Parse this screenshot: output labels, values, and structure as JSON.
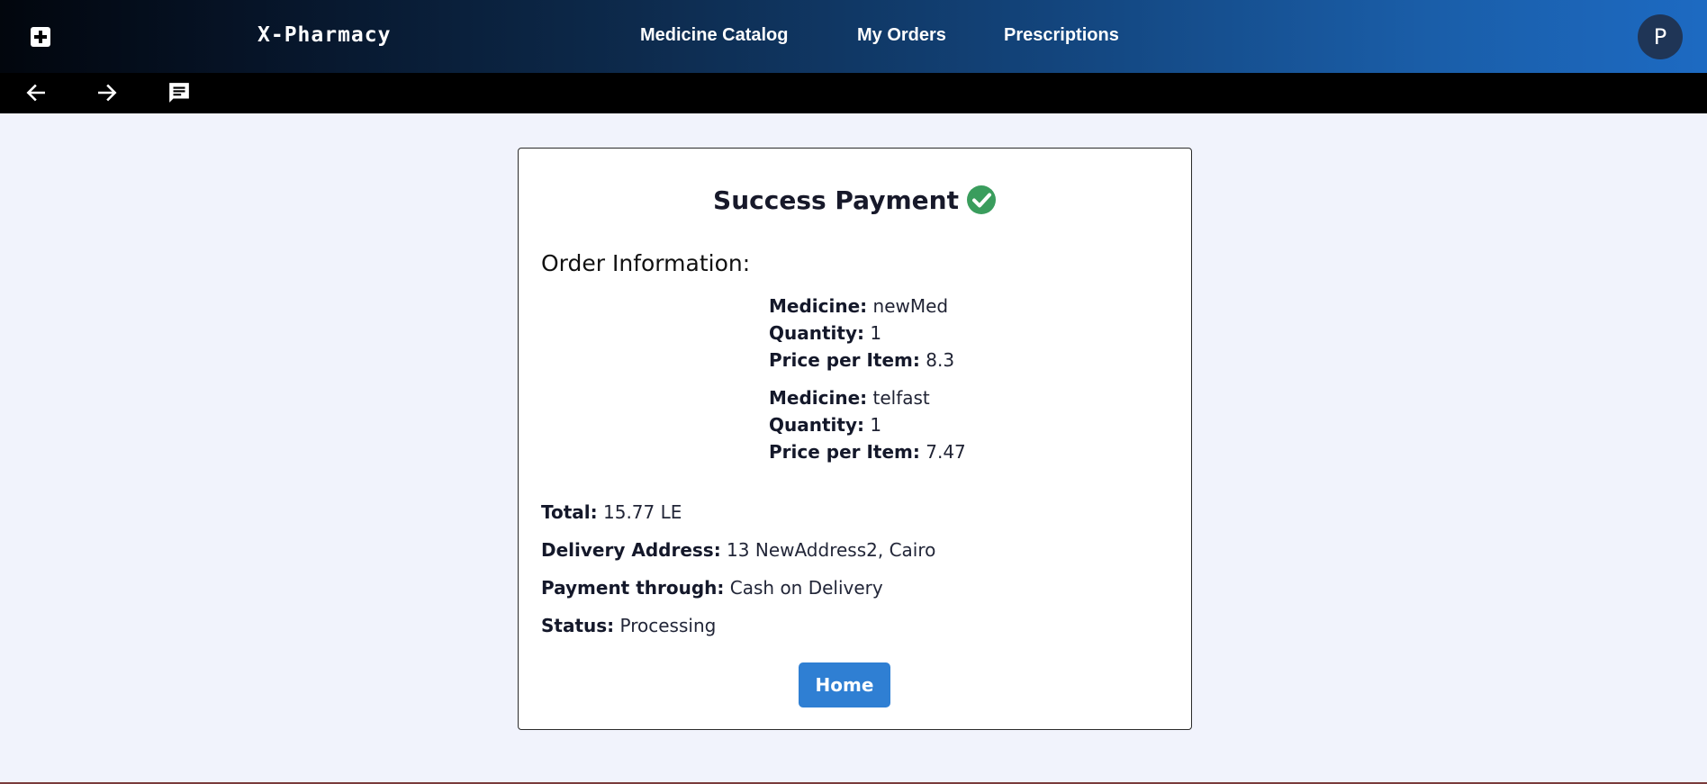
{
  "header": {
    "brand": "X-Pharmacy",
    "nav": [
      "Medicine Catalog",
      "My Orders",
      "Prescriptions"
    ],
    "avatar_initial": "P"
  },
  "toolbar": {
    "icons": [
      "arrow-left-icon",
      "arrow-right-icon",
      "chat-icon"
    ]
  },
  "page": {
    "title": "Success Payment",
    "section_heading": "Order Information:",
    "labels": {
      "medicine": "Medicine:",
      "quantity": "Quantity:",
      "price": "Price per Item:",
      "total": "Total:",
      "address": "Delivery Address:",
      "payment": "Payment through:",
      "status": "Status:"
    },
    "items": [
      {
        "medicine": "newMed",
        "quantity": "1",
        "price": "8.3"
      },
      {
        "medicine": "telfast",
        "quantity": "1",
        "price": "7.47"
      }
    ],
    "total": "15.77 LE",
    "delivery_address": "13 NewAddress2, Cairo",
    "payment_method": "Cash on Delivery",
    "status": "Processing",
    "home_button": "Home"
  },
  "colors": {
    "primary": "#2f7fd3",
    "success": "#3a9d5d",
    "background": "#f1f3fc"
  }
}
